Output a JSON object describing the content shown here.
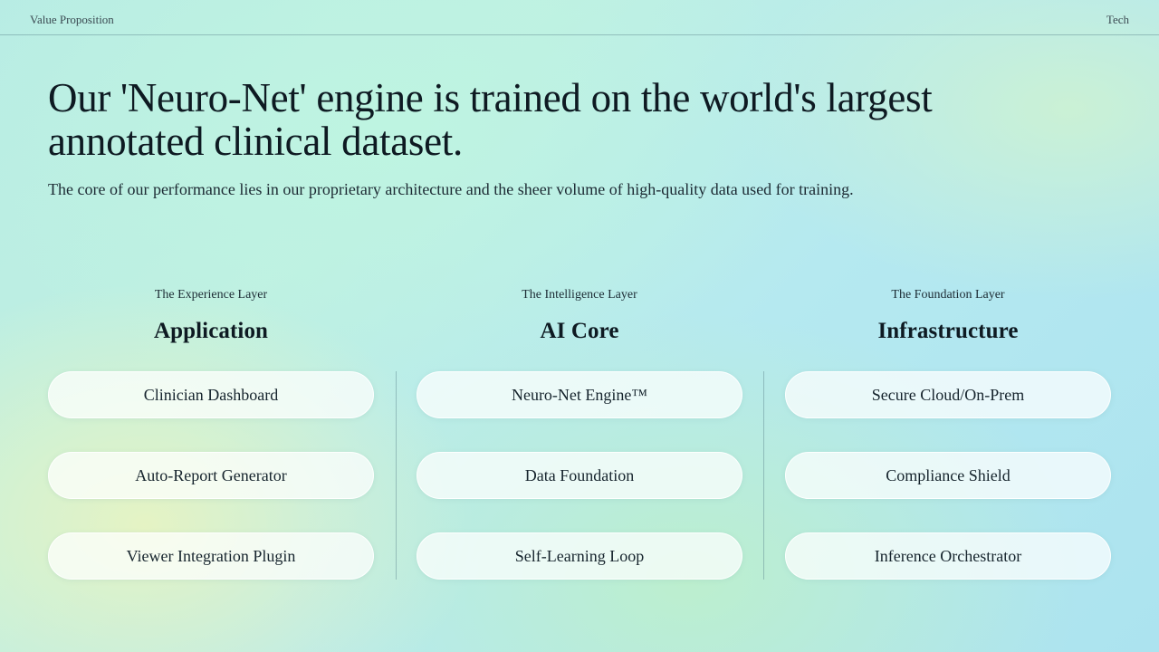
{
  "header": {
    "left_label": "Value Proposition",
    "right_label": "Tech"
  },
  "hero": {
    "headline": "Our 'Neuro-Net' engine is trained on the world's largest annotated clinical dataset.",
    "subtitle": "The core of our performance lies in our proprietary architecture and the sheer volume of high-quality data used for training."
  },
  "columns": [
    {
      "layer_label": "The Experience Layer",
      "title": "Application",
      "items": [
        "Clinician Dashboard",
        "Auto-Report Generator",
        "Viewer Integration Plugin"
      ]
    },
    {
      "layer_label": "The Intelligence Layer",
      "title": "AI Core",
      "items": [
        "Neuro-Net Engine™",
        "Data Foundation",
        "Self-Learning Loop"
      ]
    },
    {
      "layer_label": "The Foundation Layer",
      "title": "Infrastructure",
      "items": [
        "Secure Cloud/On-Prem",
        "Compliance Shield",
        "Inference Orchestrator"
      ]
    }
  ]
}
